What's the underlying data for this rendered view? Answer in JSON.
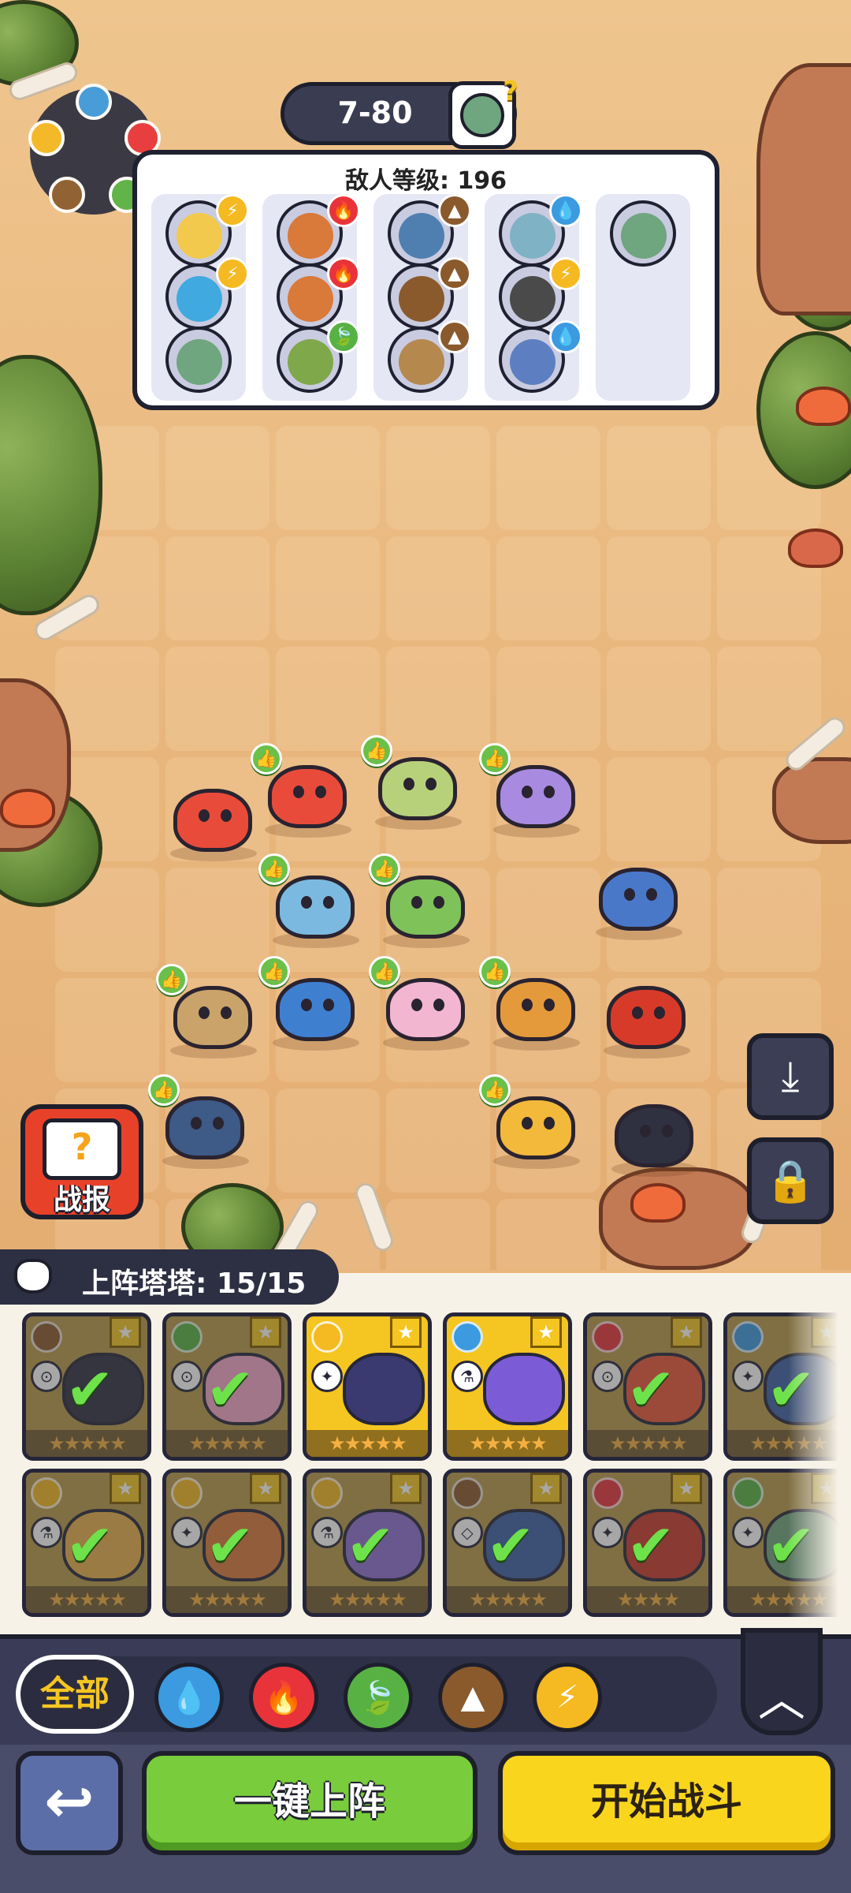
{
  "level": {
    "stage": "7-80",
    "boss_hint": "?"
  },
  "enemy_panel": {
    "title": "敌人等级: 196",
    "columns": [
      {
        "enemies": [
          {
            "color": "#f2c94c",
            "badge": "lightning",
            "badge_color": "#f5b921"
          },
          {
            "color": "#3fa9e0",
            "badge": "lightning",
            "badge_color": "#f5b921"
          },
          {
            "color": "#6fa57f",
            "badge": "",
            "badge_color": ""
          }
        ]
      },
      {
        "enemies": [
          {
            "color": "#d9793a",
            "badge": "fire",
            "badge_color": "#e8333a"
          },
          {
            "color": "#d9793a",
            "badge": "fire",
            "badge_color": "#e8333a"
          },
          {
            "color": "#7fa84a",
            "badge": "leaf",
            "badge_color": "#57b243"
          }
        ]
      },
      {
        "enemies": [
          {
            "color": "#4f7fb0",
            "badge": "earth",
            "badge_color": "#8a5a2c"
          },
          {
            "color": "#8a5a2c",
            "badge": "earth",
            "badge_color": "#8a5a2c"
          },
          {
            "color": "#b5884e",
            "badge": "earth",
            "badge_color": "#8a5a2c"
          }
        ]
      },
      {
        "enemies": [
          {
            "color": "#7fb2c4",
            "badge": "water",
            "badge_color": "#3b9ae0"
          },
          {
            "color": "#4a4a4a",
            "badge": "lightning",
            "badge_color": "#f5b921"
          },
          {
            "color": "#5d7fc2",
            "badge": "water",
            "badge_color": "#3b9ae0"
          }
        ]
      },
      {
        "enemies": [
          {
            "color": "#6fa57f",
            "badge": "",
            "badge_color": ""
          }
        ]
      }
    ]
  },
  "side_buttons": {
    "report_label": "战报",
    "report_icon": "?",
    "download_icon": "download-icon",
    "lock_icon": "lock-icon"
  },
  "roster": {
    "label": "上阵塔塔: 15/15"
  },
  "cards": [
    {
      "element_color": "#8a5a2c",
      "body": "#2f3140",
      "type_icon": "⊙",
      "stars": "★★★★★",
      "highlight": false,
      "selected": true
    },
    {
      "element_color": "#57b243",
      "body": "#f2a7c7",
      "type_icon": "⊙",
      "stars": "★★★★★",
      "highlight": false,
      "selected": true
    },
    {
      "element_color": "#f5b921",
      "body": "#3a3a70",
      "type_icon": "✦",
      "stars": "★★★★★",
      "highlight": true,
      "selected": false
    },
    {
      "element_color": "#3b9ae0",
      "body": "#7b5bd6",
      "type_icon": "⚗",
      "stars": "★★★★★",
      "highlight": true,
      "selected": false
    },
    {
      "element_color": "#e8333a",
      "body": "#e9573a",
      "type_icon": "⊙",
      "stars": "★★★★★",
      "highlight": false,
      "selected": true
    },
    {
      "element_color": "#3b9ae0",
      "body": "#3c5fa3",
      "type_icon": "✦",
      "stars": "★★★★★",
      "highlight": false,
      "selected": true
    },
    {
      "element_color": "#f5b921",
      "body": "#e8b04a",
      "type_icon": "⚗",
      "stars": "★★★★★",
      "highlight": false,
      "selected": true
    },
    {
      "element_color": "#f5b921",
      "body": "#d9793a",
      "type_icon": "✦",
      "stars": "★★★★★",
      "highlight": false,
      "selected": true
    },
    {
      "element_color": "#f5b921",
      "body": "#8e6fd1",
      "type_icon": "⚗",
      "stars": "★★★★★",
      "highlight": false,
      "selected": true
    },
    {
      "element_color": "#8a5a2c",
      "body": "#3c5fa3",
      "type_icon": "◇",
      "stars": "★★★★★",
      "highlight": false,
      "selected": true
    },
    {
      "element_color": "#e8333a",
      "body": "#c83a2a",
      "type_icon": "✦",
      "stars": "★★★★",
      "highlight": false,
      "selected": true
    },
    {
      "element_color": "#57b243",
      "body": "#6fa57f",
      "type_icon": "✦",
      "stars": "★★★★★",
      "highlight": false,
      "selected": true
    }
  ],
  "filters": {
    "all_label": "全部",
    "elements": [
      {
        "name": "water",
        "color": "#3b9ae0",
        "glyph": "💧"
      },
      {
        "name": "fire",
        "color": "#e8333a",
        "glyph": "🔥"
      },
      {
        "name": "leaf",
        "color": "#57b243",
        "glyph": "🍃"
      },
      {
        "name": "earth",
        "color": "#8a5a2c",
        "glyph": "▲"
      },
      {
        "name": "lightning",
        "color": "#f5b921",
        "glyph": "⚡"
      }
    ],
    "collapse_icon": "chevron-up-icon"
  },
  "actions": {
    "back_icon": "back-arrow-icon",
    "deploy_label": "一键上阵",
    "start_label": "开始战斗"
  },
  "field_monsters": [
    {
      "color": "#e94b3a",
      "thumb": false
    },
    {
      "color": "#e94b3a",
      "thumb": true
    },
    {
      "color": "#b7d07a",
      "thumb": true
    },
    {
      "color": "#a88be0",
      "thumb": true
    },
    {
      "color": "#7cb9e0",
      "thumb": true
    },
    {
      "color": "#7fc25a",
      "thumb": true
    },
    {
      "color": "#4a78c9",
      "thumb": false
    },
    {
      "color": "#c9a36a",
      "thumb": true
    },
    {
      "color": "#3f7fd0",
      "thumb": true
    },
    {
      "color": "#f2b6d0",
      "thumb": true
    },
    {
      "color": "#e49a3a",
      "thumb": true
    },
    {
      "color": "#d83a2a",
      "thumb": false
    },
    {
      "color": "#3e5a86",
      "thumb": true
    },
    {
      "color": "#f2b93a",
      "thumb": true
    },
    {
      "color": "#2f3140",
      "thumb": false
    }
  ]
}
